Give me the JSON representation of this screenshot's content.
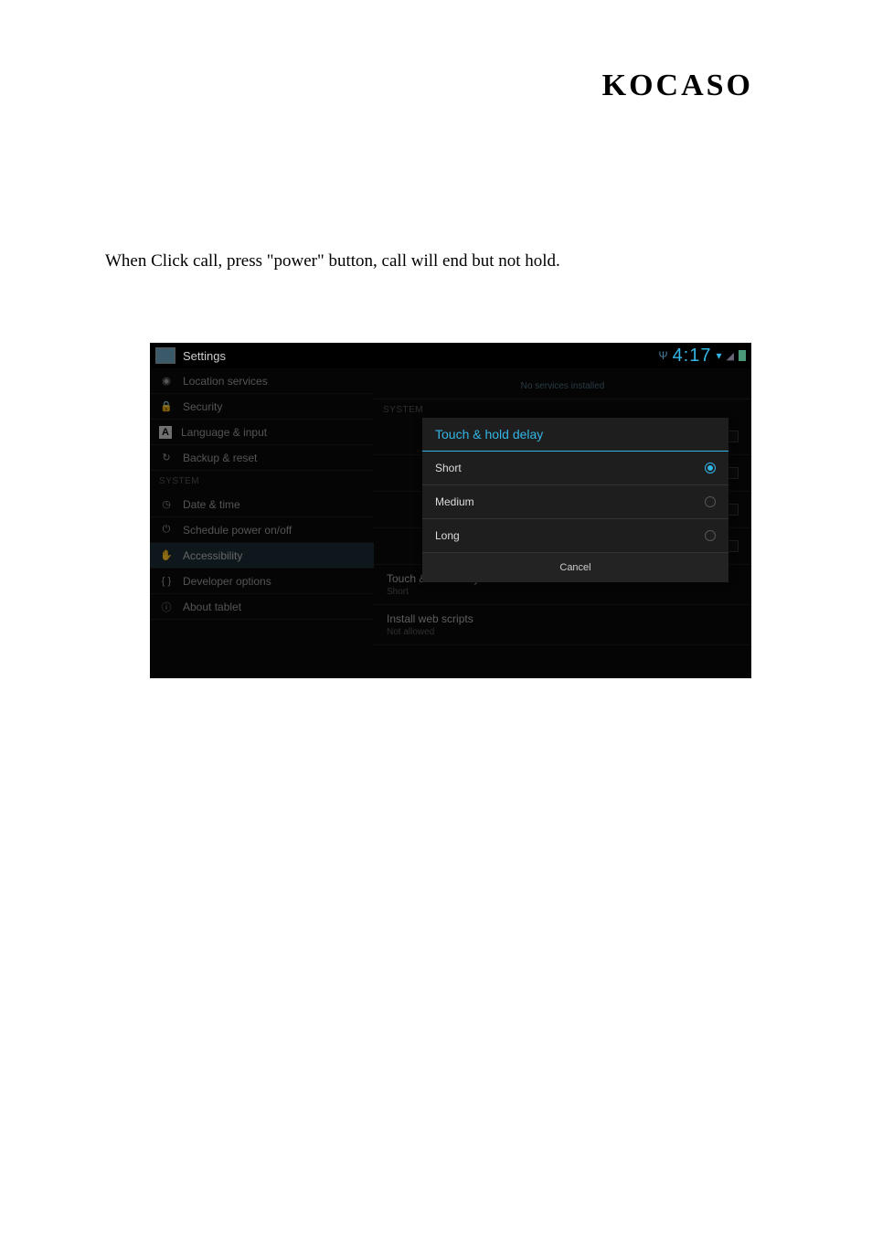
{
  "brand": "KOCASO",
  "body_text": "When Click call, press \"power\" button, call will end but not hold.",
  "statusbar": {
    "title": "Settings",
    "time": "4:17"
  },
  "sidebar": {
    "items": [
      {
        "icon": "◉",
        "label": "Location services"
      },
      {
        "icon": "🔒",
        "label": "Security"
      },
      {
        "icon": "A",
        "label": "Language & input"
      },
      {
        "icon": "↻",
        "label": "Backup & reset"
      }
    ],
    "section": "SYSTEM",
    "items2": [
      {
        "icon": "◷",
        "label": "Date & time"
      },
      {
        "icon": "⏻",
        "label": "Schedule power on/off"
      },
      {
        "icon": "✋",
        "label": "Accessibility",
        "active": true
      },
      {
        "icon": "{ }",
        "label": "Developer options"
      },
      {
        "icon": "ⓘ",
        "label": "About tablet"
      }
    ]
  },
  "main": {
    "no_services": "No services installed",
    "section": "SYSTEM",
    "items": [
      {
        "label": "",
        "sub": "",
        "check": true
      },
      {
        "label": "",
        "sub": "",
        "check": true
      },
      {
        "label": "",
        "sub": "",
        "check": true
      },
      {
        "label": "",
        "sub": "",
        "check": true
      },
      {
        "label": "Touch & hold delay",
        "sub": "Short",
        "check": false
      },
      {
        "label": "Install web scripts",
        "sub": "Not allowed",
        "check": false
      }
    ]
  },
  "dialog": {
    "title": "Touch & hold delay",
    "options": [
      {
        "label": "Short",
        "selected": true
      },
      {
        "label": "Medium",
        "selected": false
      },
      {
        "label": "Long",
        "selected": false
      }
    ],
    "cancel": "Cancel"
  }
}
